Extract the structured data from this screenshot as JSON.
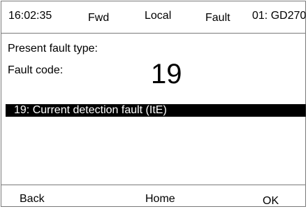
{
  "status_bar": {
    "time": "16:02:35",
    "direction": "Fwd",
    "control_mode": "Local",
    "state": "Fault",
    "device": "01: GD270"
  },
  "main": {
    "fault_type_label": "Present fault type:",
    "fault_code_label": "Fault code:",
    "fault_code_value": "19",
    "fault_description": "19: Current detection fault (ItE)"
  },
  "softkeys": {
    "back": "Back",
    "home": "Home",
    "ok": "OK"
  },
  "colors": {
    "highlight_bg": "#000000",
    "highlight_text": "#ffffff",
    "border": "#7a7a7a"
  }
}
